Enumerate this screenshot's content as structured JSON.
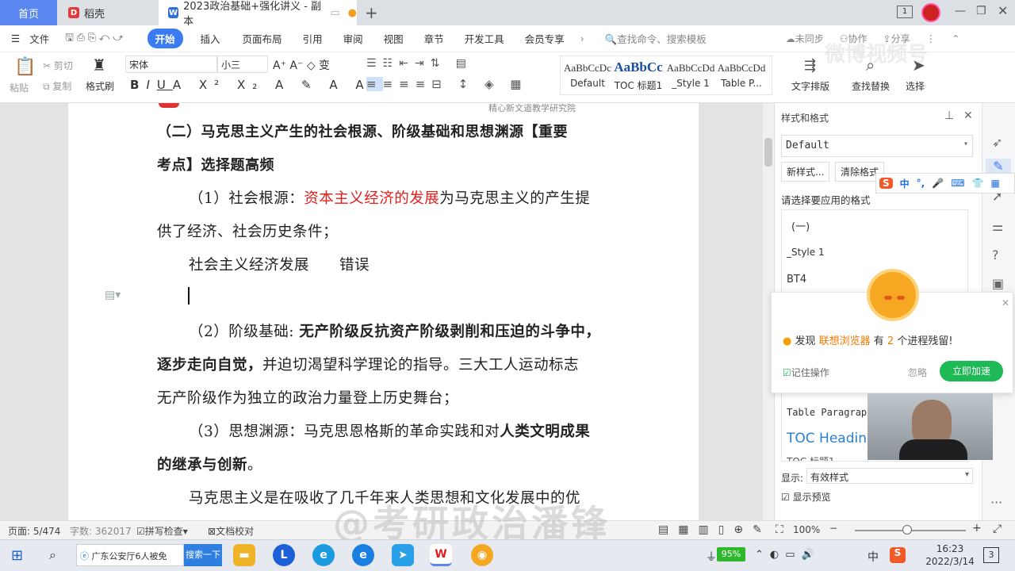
{
  "tabs": {
    "home": "首页",
    "daoke": "稻壳",
    "doc": "2023政治基础+强化讲义 - 副本"
  },
  "window": {
    "badge": "1"
  },
  "menu": [
    "文件",
    "开始",
    "插入",
    "页面布局",
    "引用",
    "审阅",
    "视图",
    "章节",
    "开发工具",
    "会员专享"
  ],
  "search_placeholder": "查找命令、搜索模板",
  "top_right": {
    "sync": "未同步",
    "collab": "协作",
    "share": "分享"
  },
  "ribbon": {
    "paste": "粘贴",
    "cut": "剪切",
    "copy": "复制",
    "format_painter": "格式刷",
    "font": "宋体",
    "size": "小三",
    "text_layout": "文字排版",
    "find_replace": "查找替换",
    "select": "选择"
  },
  "styles": [
    {
      "preview": "AaBbCcDc",
      "name": "Default"
    },
    {
      "preview": "AaBbCc",
      "name": "TOC 标题1"
    },
    {
      "preview": "AaBbCcDd",
      "name": "_Style 1"
    },
    {
      "preview": "AaBbCcDd",
      "name": "Table P..."
    }
  ],
  "doc": {
    "header_text": "精心新文道教学研究院",
    "heading_line1": "（二）马克思主义产生的社会根源、阶级基础和思想渊源【重要",
    "heading_line2": "考点】选择题高频",
    "p1_a": "（1）社会根源：",
    "p1_b": "资本主义经济的发展",
    "p1_c": "为马克思主义的产生提",
    "p1_d": "供了经济、社会历史条件；",
    "note": "社会主义经济发展　　错误",
    "p2_a": "（2）阶级基础: ",
    "p2_b": "无产阶级反抗资产阶级剥削和压迫的斗争中，",
    "p2_c": "逐步走向自觉，",
    "p2_d": "并迫切渴望科学理论的指导。三大工人运动标志",
    "p2_e": "无产阶级作为独立的政治力量登上历史舞台；",
    "p3_a": "（3）思想渊源：马克思恩格斯的革命实践和对",
    "p3_b": "人类文明成果",
    "p3_c": "的继承与创新",
    "p3_d": "。",
    "p4": "马克思主义是在吸收了几千年来人类思想和文化发展中的优"
  },
  "panel": {
    "title": "样式和格式",
    "current": "Default",
    "new_style": "新样式...",
    "clear": "清除格式",
    "apply_label": "请选择要应用的格式",
    "list": [
      "(一)",
      "_Style 1",
      "BT4",
      "Table Paragraph",
      "TOC Heading",
      "TOC 标题1"
    ],
    "show_label": "显示:",
    "show_value": "有效样式",
    "preview": "显示预览"
  },
  "sogou": {
    "cn": "中",
    "punct": "°,"
  },
  "popup": {
    "msg_a": "发现 ",
    "browser": "联想浏览器",
    "msg_b": " 有 ",
    "count": "2",
    "msg_c": " 个进程残留!",
    "remember": "记住操作",
    "ignore": "忽略",
    "accelerate": "立即加速"
  },
  "status": {
    "page": "页面: 5/474",
    "words": "字数: 362017",
    "spell": "拼写检查",
    "proof": "文档校对",
    "zoom": "100%"
  },
  "watermark": "@考研政治潘锋",
  "watermark2": "微博视频号",
  "taskbar": {
    "search_text": "广东公安厅6人被免",
    "search_btn": "搜索一下",
    "battery": "95%",
    "time": "16:23",
    "date": "2022/3/14",
    "ime": "中",
    "notif": "3"
  },
  "colors": {
    "accent": "#3a7bf2",
    "red_text": "#e02020",
    "green": "#1db954"
  }
}
